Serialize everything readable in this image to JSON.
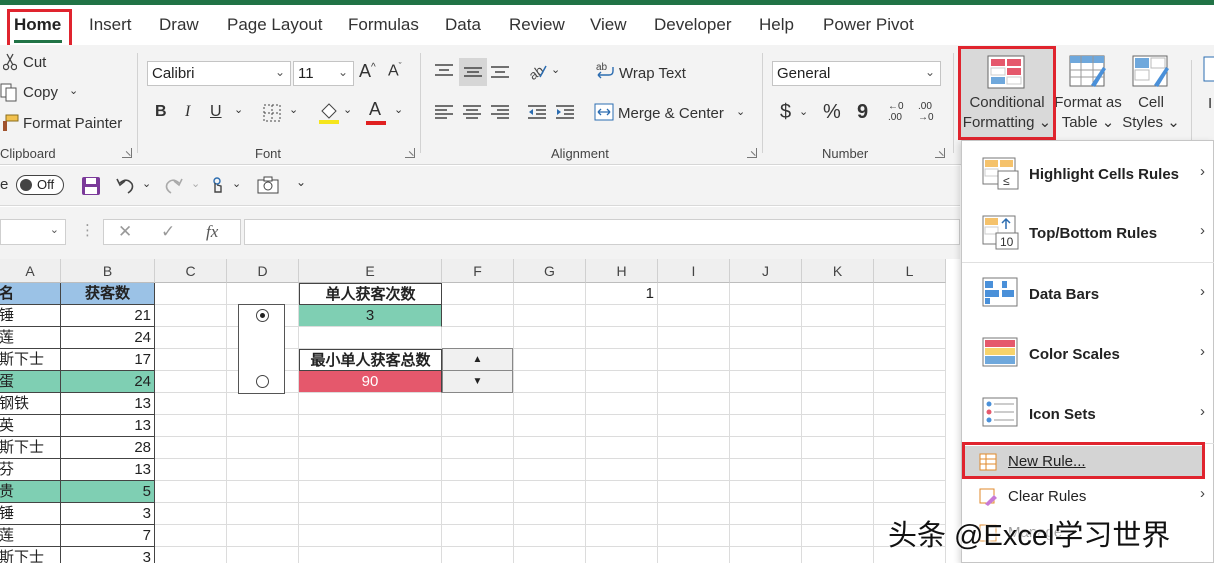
{
  "tabs": [
    "Home",
    "Insert",
    "Draw",
    "Page Layout",
    "Formulas",
    "Data",
    "Review",
    "View",
    "Developer",
    "Help",
    "Power Pivot"
  ],
  "clipboard": {
    "cut": "Cut",
    "copy": "Copy",
    "format_painter": "Format Painter",
    "group": "Clipboard"
  },
  "font": {
    "name": "Calibri",
    "size": "11",
    "group": "Font",
    "bold": "B",
    "italic": "I",
    "underline": "U",
    "font_color": "A"
  },
  "alignment": {
    "wrap": "Wrap Text",
    "merge": "Merge & Center",
    "group": "Alignment"
  },
  "number": {
    "format": "General",
    "group": "Number",
    "currency": "$",
    "percent": "%",
    "comma": "9",
    "inc_dec": "←0\n.00",
    "dec_dec": ".00\n→0"
  },
  "styles": {
    "conditional_formatting": [
      "Conditional",
      "Formatting ⌄"
    ],
    "format_as_table": [
      "Format as",
      "Table ⌄"
    ],
    "cell_styles": [
      "Cell",
      "Styles ⌄"
    ],
    "insert_partial": "I"
  },
  "qat": {
    "autosave_prefix": "e",
    "toggle_label": "Off"
  },
  "formula": {
    "fx": "fx"
  },
  "columns": [
    "A",
    "B",
    "C",
    "D",
    "E",
    "F",
    "G",
    "H",
    "I",
    "J",
    "K",
    "L"
  ],
  "table": {
    "header": {
      "a": "姓名",
      "b": "获客数"
    },
    "rows": [
      {
        "a": "大锤",
        "b": "21",
        "hl": false
      },
      {
        "a": "秋莲",
        "b": "24",
        "hl": false
      },
      {
        "a": "克斯下士",
        "b": "17",
        "hl": false
      },
      {
        "a": "铁蛋",
        "b": "24",
        "hl": true
      },
      {
        "a": "高钢铁",
        "b": "13",
        "hl": false
      },
      {
        "a": "凤英",
        "b": "13",
        "hl": false
      },
      {
        "a": "克斯下士",
        "b": "28",
        "hl": false
      },
      {
        "a": "淑芬",
        "b": "13",
        "hl": false
      },
      {
        "a": "富贵",
        "b": "5",
        "hl": true
      },
      {
        "a": "大锤",
        "b": "3",
        "hl": false
      },
      {
        "a": "秋莲",
        "b": "7",
        "hl": false
      },
      {
        "a": "克斯下士",
        "b": "3",
        "hl": false
      }
    ]
  },
  "panel": {
    "e1_label": "单人获客次数",
    "e2_value": "3",
    "e4_label": "最小单人获客总数",
    "e5_value": "90",
    "h1_value": "1",
    "spin_up": "▲",
    "spin_down": "▼"
  },
  "menu": {
    "items": [
      {
        "label": "Highlight Cells Rules",
        "sub": true
      },
      {
        "label": "Top/Bottom Rules",
        "sub": true
      },
      {
        "label": "Data Bars",
        "sub": true
      },
      {
        "label": "Color Scales",
        "sub": true
      },
      {
        "label": "Icon Sets",
        "sub": true
      }
    ],
    "new_rule": "New Rule...",
    "clear_rules": "Clear Rules",
    "manage_partial": "Manage"
  },
  "watermark": "头条 @Excel学习世界",
  "colors": {
    "accent": "#217346",
    "highlight": "#e0242e",
    "green_cell": "#7fcfb3",
    "red_cell": "#e5586c",
    "blue_header": "#9bc2e6"
  }
}
